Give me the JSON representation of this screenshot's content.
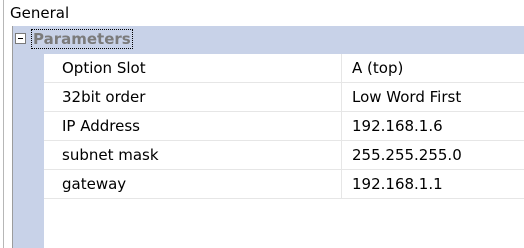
{
  "group": {
    "title": "General"
  },
  "category": {
    "label": "Parameters",
    "expander_icon": "minus-box-icon",
    "expanded": true
  },
  "properties": [
    {
      "name": "Option Slot",
      "value": "A (top)"
    },
    {
      "name": "32bit order",
      "value": "Low Word First"
    },
    {
      "name": "IP Address",
      "value": "192.168.1.6"
    },
    {
      "name": "subnet mask",
      "value": "255.255.255.0"
    },
    {
      "name": "gateway",
      "value": "192.168.1.1"
    }
  ],
  "colors": {
    "category_background": "#c8d2e8",
    "category_text": "#7b7b7b",
    "grid_line": "#e6e6e6"
  }
}
